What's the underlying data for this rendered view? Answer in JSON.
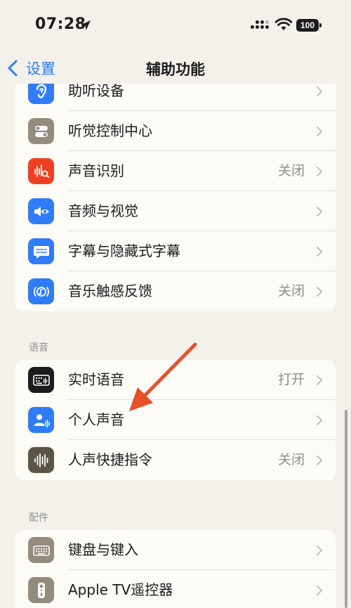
{
  "status": {
    "time": "07:28",
    "battery": "100"
  },
  "nav": {
    "back_label": "设置",
    "title": "辅助功能"
  },
  "groups": {
    "hearing": [
      {
        "label": "助听设备",
        "value": ""
      },
      {
        "label": "听觉控制中心",
        "value": ""
      },
      {
        "label": "声音识别",
        "value": "关闭"
      },
      {
        "label": "音频与视觉",
        "value": ""
      },
      {
        "label": "字幕与隐藏式字幕",
        "value": ""
      },
      {
        "label": "音乐触感反馈",
        "value": "关闭"
      }
    ],
    "speech_header": "语音",
    "speech": [
      {
        "label": "实时语音",
        "value": "打开"
      },
      {
        "label": "个人声音",
        "value": ""
      },
      {
        "label": "人声快捷指令",
        "value": "关闭"
      }
    ],
    "accessories_header": "配件",
    "accessories": [
      {
        "label": "键盘与键入",
        "value": ""
      },
      {
        "label": "Apple TV遥控器",
        "value": ""
      }
    ]
  },
  "icons": {
    "hearing-devices": "ear-icon",
    "hearing-control": "toggles-icon",
    "sound-recognition": "waveform-search-icon",
    "audio-visual": "speaker-eye-icon",
    "subtitles": "caption-bubble-icon",
    "music-haptics": "music-haptics-icon",
    "live-speech": "keyboard-waveform-icon",
    "personal-voice": "person-waveform-icon",
    "vocal-shortcuts": "waveform-icon",
    "keyboard": "keyboard-icon",
    "apple-tv-remote": "remote-icon"
  },
  "colors": {
    "accent_blue": "#2f7cf6",
    "icon_blue": "#2f7cf6",
    "icon_gray": "#948b7f",
    "icon_red": "#ef3f22",
    "icon_black": "#1c1c1e",
    "icon_olive": "#5b5548",
    "annotation_arrow": "#e8502a"
  }
}
